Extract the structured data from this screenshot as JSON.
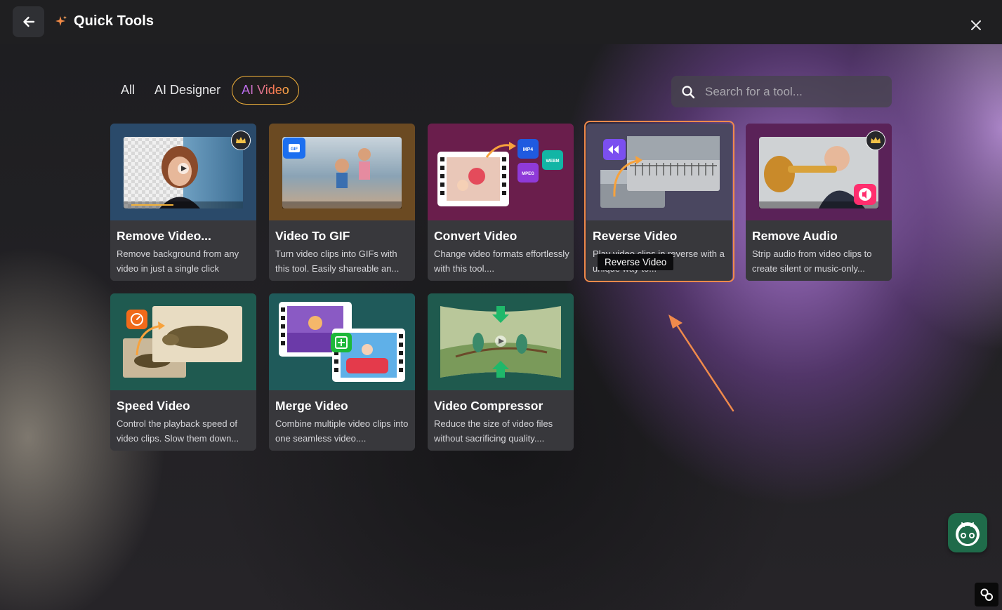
{
  "header": {
    "title": "Quick Tools",
    "back_icon": "arrow-left-icon",
    "sparkle_icon": "sparkle-icon",
    "close_icon": "close-icon"
  },
  "tabs": [
    {
      "label": "All",
      "active": false
    },
    {
      "label": "AI Designer",
      "active": false
    },
    {
      "label": "AI Video",
      "active": true
    }
  ],
  "search": {
    "placeholder": "Search for a tool..."
  },
  "tools": [
    {
      "title": "Remove Video...",
      "description": "Remove background from any video in just a single click",
      "premium": true
    },
    {
      "title": "Video To GIF",
      "description": "Turn video clips into GIFs with this tool. Easily shareable an...",
      "premium": false
    },
    {
      "title": "Convert Video",
      "description": "Change video formats effortlessly with this tool....",
      "premium": false
    },
    {
      "title": "Reverse Video",
      "description": "Play video clips in reverse with a unique way to...",
      "premium": false,
      "highlighted": true
    },
    {
      "title": "Remove Audio",
      "description": "Strip audio from video clips to create silent or music-only...",
      "premium": true
    },
    {
      "title": "Speed Video",
      "description": "Control the playback speed of video clips. Slow them down...",
      "premium": false
    },
    {
      "title": "Merge Video",
      "description": "Combine multiple video clips into one seamless video....",
      "premium": false
    },
    {
      "title": "Video Compressor",
      "description": "Reduce the size of video files without sacrificing quality....",
      "premium": false
    }
  ],
  "format_badges": {
    "mp4": "MP4",
    "webm": "WEBM",
    "mpeg": "MPEG",
    "gif": "GIF"
  },
  "tooltip": "Reverse Video",
  "colors": {
    "accent": "#f08a4b",
    "active_tab_border": "#f3b23a"
  }
}
